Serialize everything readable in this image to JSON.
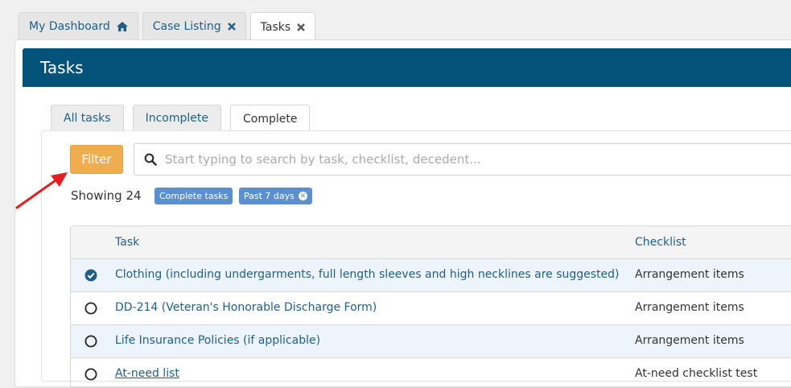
{
  "top_tabs": [
    {
      "label": "My Dashboard",
      "icon": "home-icon"
    },
    {
      "label": "Case Listing",
      "icon": "close-icon"
    },
    {
      "label": "Tasks",
      "icon": "close-icon"
    }
  ],
  "header": {
    "title": "Tasks"
  },
  "inner_tabs": [
    {
      "label": "All tasks"
    },
    {
      "label": "Incomplete"
    },
    {
      "label": "Complete"
    }
  ],
  "filter": {
    "button_label": "Filter"
  },
  "search": {
    "placeholder": "Start typing to search by task, checklist, decedent..."
  },
  "results": {
    "showing_text": "Showing 24",
    "badges": [
      {
        "label": "Complete tasks"
      },
      {
        "label": "Past 7 days"
      }
    ]
  },
  "table": {
    "columns": [
      "Task",
      "Checklist"
    ],
    "rows": [
      {
        "task": "Clothing (including undergarments, full length sleeves and high necklines are suggested)",
        "checklist": "Arrangement items",
        "checked": true
      },
      {
        "task": "DD-214 (Veteran's Honorable Discharge Form)",
        "checklist": "Arrangement items",
        "checked": false
      },
      {
        "task": "Life Insurance Policies (if applicable)",
        "checklist": "Arrangement items",
        "checked": false
      },
      {
        "task": "At-need list",
        "checklist": "At-need checklist test",
        "checked": false
      }
    ]
  },
  "colors": {
    "header_bg": "#02527a",
    "link": "#1f5f86",
    "filter_button": "#f0ad4e",
    "badge": "#5b8fce",
    "arrow": "#e02020"
  }
}
